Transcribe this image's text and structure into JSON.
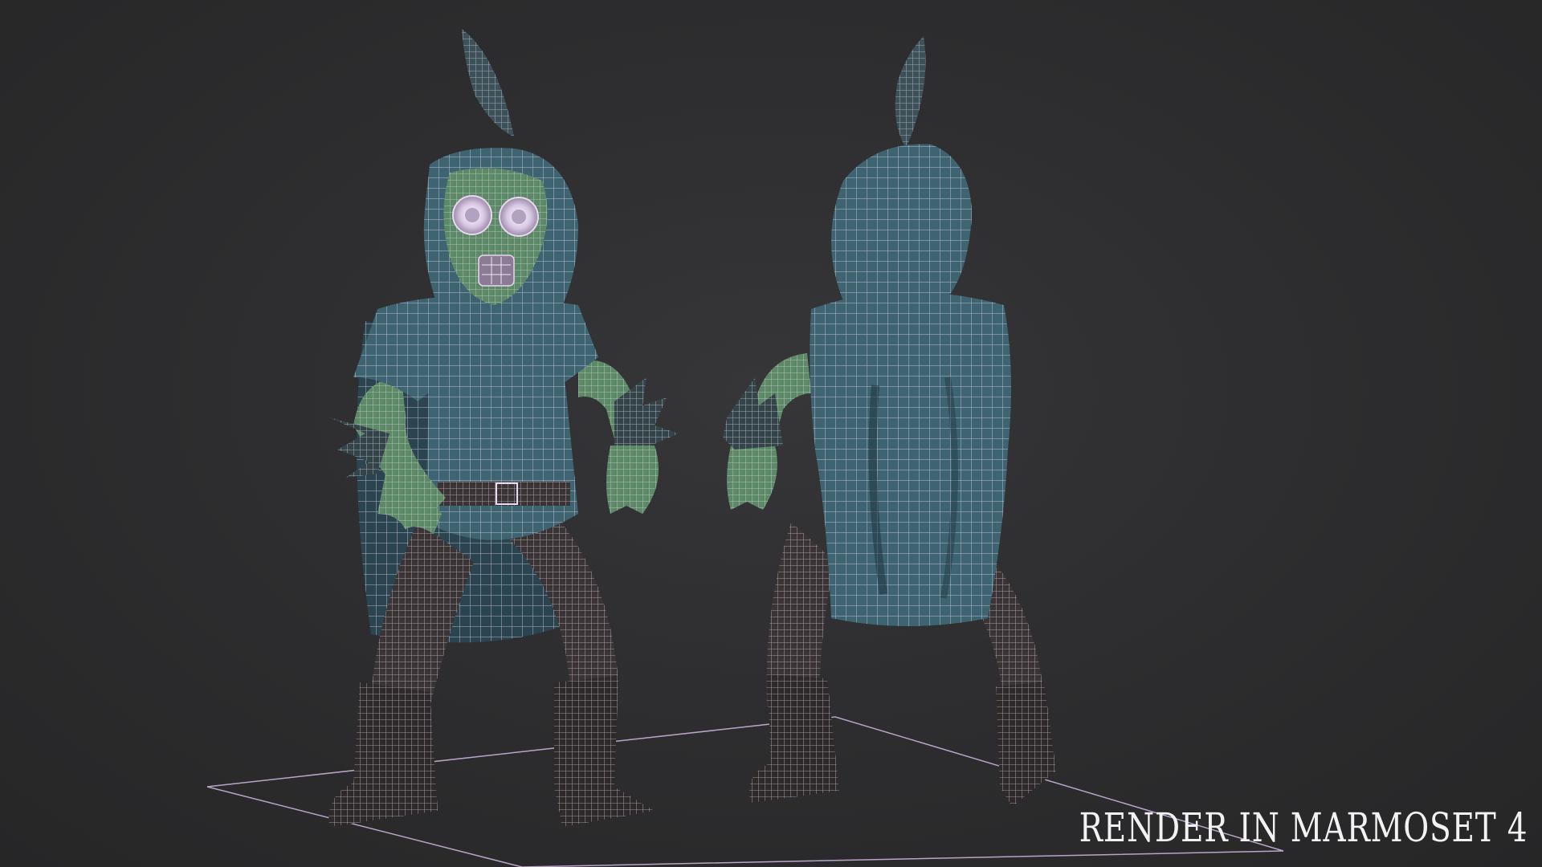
{
  "image": {
    "caption": "RENDER IN MARMOSET 4"
  },
  "colors": {
    "background": "#2e2e30",
    "wireframe": "#e8d8f2",
    "cloak": "#3d6470",
    "cloak_dark": "#2a4550",
    "skin": "#5d8a66",
    "pants": "#3a3434",
    "boots": "#2e2a2a",
    "ground_line": "#b9a4c8"
  }
}
